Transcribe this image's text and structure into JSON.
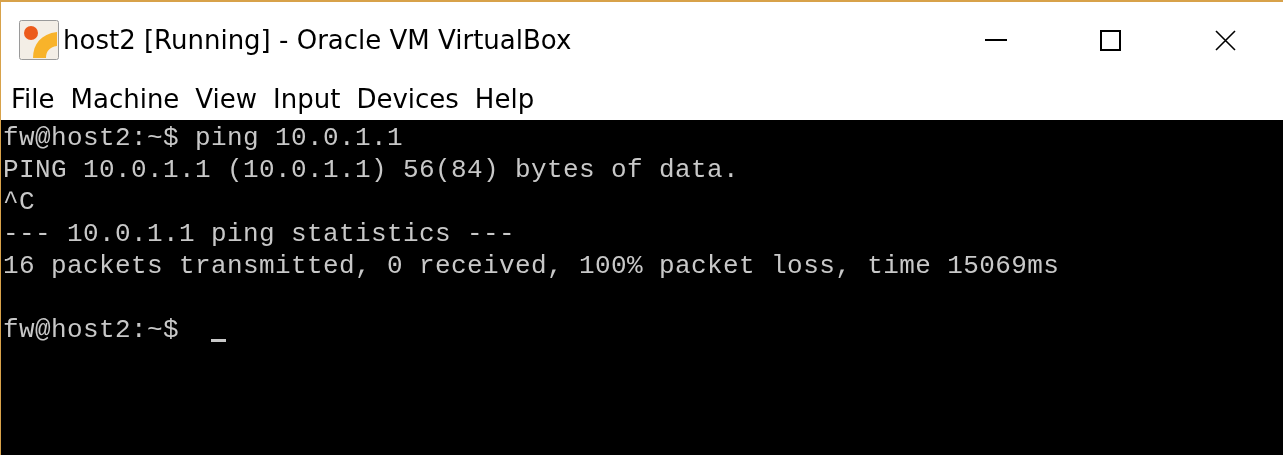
{
  "window": {
    "title": "host2 [Running] - Oracle VM VirtualBox"
  },
  "menu": [
    "File",
    "Machine",
    "View",
    "Input",
    "Devices",
    "Help"
  ],
  "terminal": {
    "lines": [
      {
        "kind": "text",
        "text": "fw@host2:~$ ping 10.0.1.1"
      },
      {
        "kind": "text",
        "text": "PING 10.0.1.1 (10.0.1.1) 56(84) bytes of data."
      },
      {
        "kind": "text",
        "text": "^C"
      },
      {
        "kind": "text",
        "text": "--- 10.0.1.1 ping statistics ---"
      },
      {
        "kind": "text",
        "text": "16 packets transmitted, 0 received, 100% packet loss, time 15069ms"
      },
      {
        "kind": "blank"
      },
      {
        "kind": "text",
        "text": "fw@host2:~$ ",
        "cursor": true
      }
    ]
  }
}
